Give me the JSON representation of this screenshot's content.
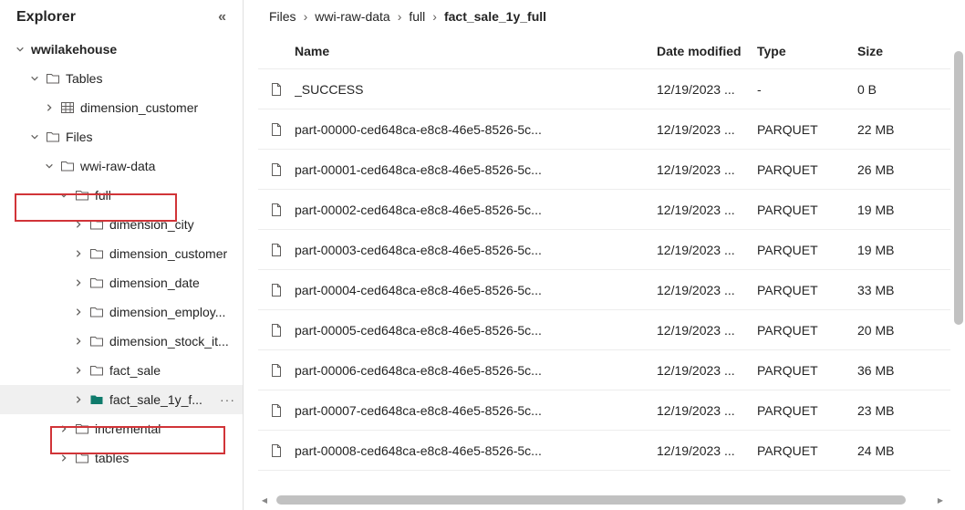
{
  "sidebar": {
    "title": "Explorer",
    "root": {
      "label": "wwilakehouse",
      "children": [
        {
          "label": "Tables",
          "expanded": true,
          "children": [
            {
              "label": "dimension_customer",
              "icon": "cube"
            }
          ]
        },
        {
          "label": "Files",
          "expanded": true,
          "children": [
            {
              "label": "wwi-raw-data",
              "expanded": true,
              "highlight": true,
              "children": [
                {
                  "label": "full",
                  "expanded": true,
                  "children": [
                    {
                      "label": "dimension_city"
                    },
                    {
                      "label": "dimension_customer"
                    },
                    {
                      "label": "dimension_date"
                    },
                    {
                      "label": "dimension_employ..."
                    },
                    {
                      "label": "dimension_stock_it..."
                    },
                    {
                      "label": "fact_sale"
                    },
                    {
                      "label": "fact_sale_1y_f...",
                      "selected": true,
                      "highlight": true,
                      "icon": "folder-teal",
                      "more": true
                    }
                  ]
                },
                {
                  "label": "incremental"
                },
                {
                  "label": "tables"
                }
              ]
            }
          ]
        }
      ]
    }
  },
  "breadcrumb": [
    "Files",
    "wwi-raw-data",
    "full",
    "fact_sale_1y_full"
  ],
  "table": {
    "headers": {
      "name": "Name",
      "date": "Date modified",
      "type": "Type",
      "size": "Size"
    },
    "rows": [
      {
        "name": "_SUCCESS",
        "date": "12/19/2023 ...",
        "type": "-",
        "size": "0 B"
      },
      {
        "name": "part-00000-ced648ca-e8c8-46e5-8526-5c...",
        "date": "12/19/2023 ...",
        "type": "PARQUET",
        "size": "22 MB"
      },
      {
        "name": "part-00001-ced648ca-e8c8-46e5-8526-5c...",
        "date": "12/19/2023 ...",
        "type": "PARQUET",
        "size": "26 MB"
      },
      {
        "name": "part-00002-ced648ca-e8c8-46e5-8526-5c...",
        "date": "12/19/2023 ...",
        "type": "PARQUET",
        "size": "19 MB"
      },
      {
        "name": "part-00003-ced648ca-e8c8-46e5-8526-5c...",
        "date": "12/19/2023 ...",
        "type": "PARQUET",
        "size": "19 MB"
      },
      {
        "name": "part-00004-ced648ca-e8c8-46e5-8526-5c...",
        "date": "12/19/2023 ...",
        "type": "PARQUET",
        "size": "33 MB"
      },
      {
        "name": "part-00005-ced648ca-e8c8-46e5-8526-5c...",
        "date": "12/19/2023 ...",
        "type": "PARQUET",
        "size": "20 MB"
      },
      {
        "name": "part-00006-ced648ca-e8c8-46e5-8526-5c...",
        "date": "12/19/2023 ...",
        "type": "PARQUET",
        "size": "36 MB"
      },
      {
        "name": "part-00007-ced648ca-e8c8-46e5-8526-5c...",
        "date": "12/19/2023 ...",
        "type": "PARQUET",
        "size": "23 MB"
      },
      {
        "name": "part-00008-ced648ca-e8c8-46e5-8526-5c...",
        "date": "12/19/2023 ...",
        "type": "PARQUET",
        "size": "24 MB"
      }
    ]
  }
}
